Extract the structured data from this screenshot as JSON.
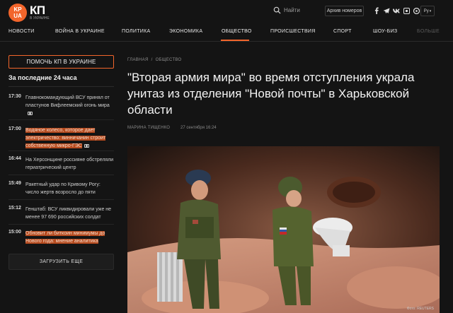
{
  "header": {
    "logo_top": "KP",
    "logo_bottom": "UA",
    "brand": "КП",
    "brand_sub": "В УКРАИНЕ",
    "search_placeholder": "Найти",
    "archive_label": "Архив номеров",
    "socials": [
      "facebook-icon",
      "telegram-icon",
      "vk-icon",
      "ok-icon",
      "viber-icon"
    ],
    "lang": "Ру"
  },
  "nav": {
    "items": [
      "НОВОСТИ",
      "ВОЙНА В УКРАИНЕ",
      "ПОЛИТИКА",
      "ЭКОНОМИКА",
      "ОБЩЕСТВО",
      "ПРОИСШЕСТВИЯ",
      "СПОРТ",
      "ШОУ-БИЗ",
      "БОЛЬШЕ"
    ],
    "active": "ОБЩЕСТВО"
  },
  "sidebar": {
    "help_button": "ПОМОЧЬ КП В УКРАИНЕ",
    "title": "За последние 24 часа",
    "news": [
      {
        "time": "17:30",
        "text": "Главнокомандующий ВСУ принял от пластунов Вифлеемский огонь мира",
        "photo": true,
        "highlight": false
      },
      {
        "time": "17:00",
        "text": "Водяное колесо, которое дает электричество: винничанин строит собственную микро-ГЭС",
        "photo": true,
        "highlight": true
      },
      {
        "time": "16:44",
        "text": "На Херсонщине россияне обстреляли гериатрический центр",
        "photo": false,
        "highlight": false
      },
      {
        "time": "15:49",
        "text": "Ракетный удар по Кривому Рогу: число жертв возросло до пяти",
        "photo": false,
        "highlight": false
      },
      {
        "time": "15:12",
        "text": "Генштаб: ВСУ ликвидировали уже не менее 97 690 российских солдат",
        "photo": false,
        "highlight": false
      },
      {
        "time": "15:00",
        "text": "Обновит ли биткоин минимумы до Нового года: мнение аналитика",
        "photo": false,
        "highlight": true
      }
    ],
    "load_more": "ЗАГРУЗИТЬ ЕЩЕ"
  },
  "article": {
    "breadcrumb": [
      "ГЛАВНАЯ",
      "ОБЩЕСТВО"
    ],
    "title": "\"Вторая армия мира\" во время отступления украла унитаз из отделения \"Новой почты\" в Харьковской области",
    "author": "МАРИНА ТИЩЕНКО",
    "date": "27 сентября 16:24",
    "photo_credit": "Фото: REUTERS"
  },
  "colors": {
    "accent": "#f2652b",
    "background": "#141414",
    "highlight_bg": "#b54a1e"
  }
}
